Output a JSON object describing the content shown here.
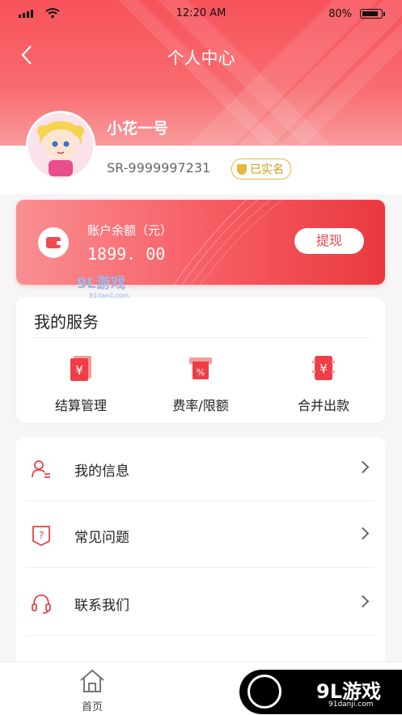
{
  "status_bar": {
    "time": "12:20 AM",
    "battery_percent": "80%",
    "battery_level": 0.8
  },
  "header": {
    "title": "个人中心"
  },
  "profile": {
    "username": "小花一号",
    "user_id": "SR-9999997231",
    "verified_label": "已实名"
  },
  "balance": {
    "label": "账户余额（元）",
    "amount": "1899. 00",
    "withdraw_label": "提现"
  },
  "watermark": {
    "text": "9L游戏",
    "subtext": "91danji.com"
  },
  "services": {
    "title": "我的服务",
    "items": [
      {
        "label": "结算管理",
        "icon": "settlement-icon"
      },
      {
        "label": "费率/限额",
        "icon": "rate-limit-icon"
      },
      {
        "label": "合并出款",
        "icon": "merge-payout-icon"
      }
    ]
  },
  "menu": {
    "items": [
      {
        "label": "我的信息",
        "icon": "user-info-icon"
      },
      {
        "label": "常见问题",
        "icon": "faq-icon"
      },
      {
        "label": "联系我们",
        "icon": "headset-icon"
      }
    ]
  },
  "tabbar": {
    "home_label": "首页"
  },
  "corner_watermark": {
    "text": "9L游戏",
    "subtext": "91danji.com"
  },
  "colors": {
    "brand_red": "#f04a51",
    "gold": "#e6b640"
  }
}
